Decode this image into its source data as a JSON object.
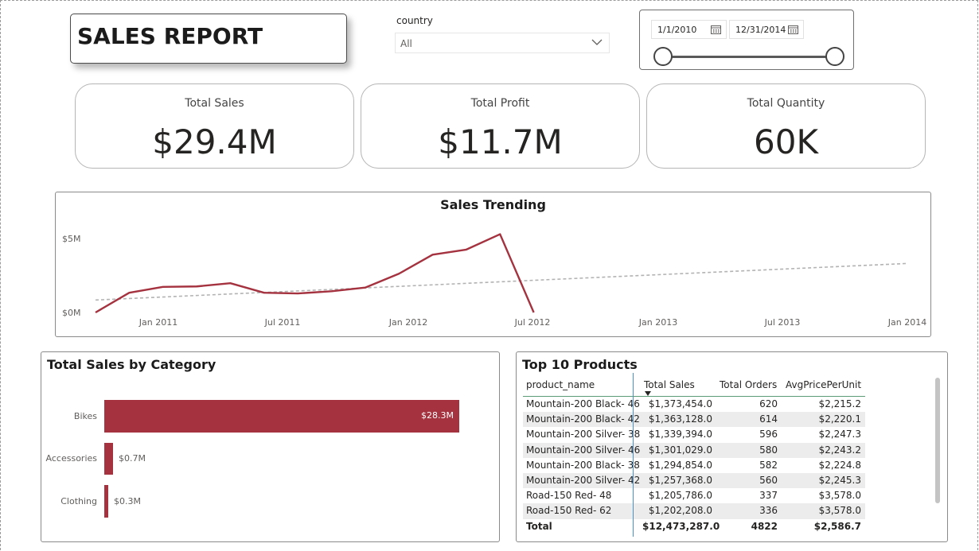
{
  "report_title": "SALES REPORT",
  "country_slicer": {
    "label": "country",
    "selected": "All"
  },
  "date_slicer": {
    "start": "1/1/2010",
    "end": "12/31/2014"
  },
  "kpis": [
    {
      "label": "Total Sales",
      "value": "$29.4M"
    },
    {
      "label": "Total Profit",
      "value": "$11.7M"
    },
    {
      "label": "Total Quantity",
      "value": "60K"
    }
  ],
  "sales_trend": {
    "title": "Sales Trending",
    "y_ticks": [
      "$5M",
      "$0M"
    ],
    "x_ticks": [
      "Jan 2011",
      "Jul 2011",
      "Jan 2012",
      "Jul 2012",
      "Jan 2013",
      "Jul 2013",
      "Jan 2014"
    ]
  },
  "category_chart": {
    "title": "Total Sales by Category",
    "bars": [
      {
        "label": "Bikes",
        "value_label": "$28.3M"
      },
      {
        "label": "Accessories",
        "value_label": "$0.7M"
      },
      {
        "label": "Clothing",
        "value_label": "$0.3M"
      }
    ]
  },
  "top_products": {
    "title": "Top 10 Products",
    "columns": [
      "product_name",
      "Total Sales",
      "Total Orders",
      "AvgPricePerUnit"
    ],
    "rows": [
      [
        "Mountain-200 Black- 46",
        "$1,373,454.0",
        "620",
        "$2,215.2"
      ],
      [
        "Mountain-200 Black- 42",
        "$1,363,128.0",
        "614",
        "$2,220.1"
      ],
      [
        "Mountain-200 Silver- 38",
        "$1,339,394.0",
        "596",
        "$2,247.3"
      ],
      [
        "Mountain-200 Silver- 46",
        "$1,301,029.0",
        "580",
        "$2,243.2"
      ],
      [
        "Mountain-200 Black- 38",
        "$1,294,854.0",
        "582",
        "$2,224.8"
      ],
      [
        "Mountain-200 Silver- 42",
        "$1,257,368.0",
        "560",
        "$2,245.3"
      ],
      [
        "Road-150 Red- 48",
        "$1,205,786.0",
        "337",
        "$3,578.0"
      ],
      [
        "Road-150 Red- 62",
        "$1,202,208.0",
        "336",
        "$3,578.0"
      ]
    ],
    "total": [
      "Total",
      "$12,473,287.0",
      "4822",
      "$2,586.7"
    ]
  },
  "colors": {
    "accent": "#a4323f",
    "trendline": "#b3b3b3"
  },
  "chart_data": [
    {
      "type": "line",
      "title": "Sales Trending",
      "x": [
        "2010-07",
        "2011-01",
        "2011-07",
        "2012-01",
        "2012-07",
        "2013-01",
        "2013-07",
        "2014-01"
      ],
      "x_full": [
        "2010-07",
        "2010-10",
        "2011-01",
        "2011-04",
        "2011-07",
        "2011-10",
        "2012-01",
        "2012-04",
        "2012-07",
        "2012-10",
        "2013-01",
        "2013-04",
        "2013-07",
        "2013-10",
        "2014-01"
      ],
      "series": [
        {
          "values": [
            0.0,
            1.35,
            1.75,
            1.78,
            2.0,
            1.35,
            1.3,
            1.45,
            1.7,
            2.65,
            3.95,
            4.3,
            5.35,
            0.0
          ]
        }
      ],
      "trendline": [
        0.85,
        3.35
      ],
      "ylim": [
        0,
        6
      ],
      "y_ticks": [
        "$0M",
        "$5M"
      ]
    },
    {
      "type": "bar",
      "title": "Total Sales by Category",
      "categories": [
        "Bikes",
        "Accessories",
        "Clothing"
      ],
      "values": [
        28.3,
        0.7,
        0.3
      ]
    }
  ]
}
